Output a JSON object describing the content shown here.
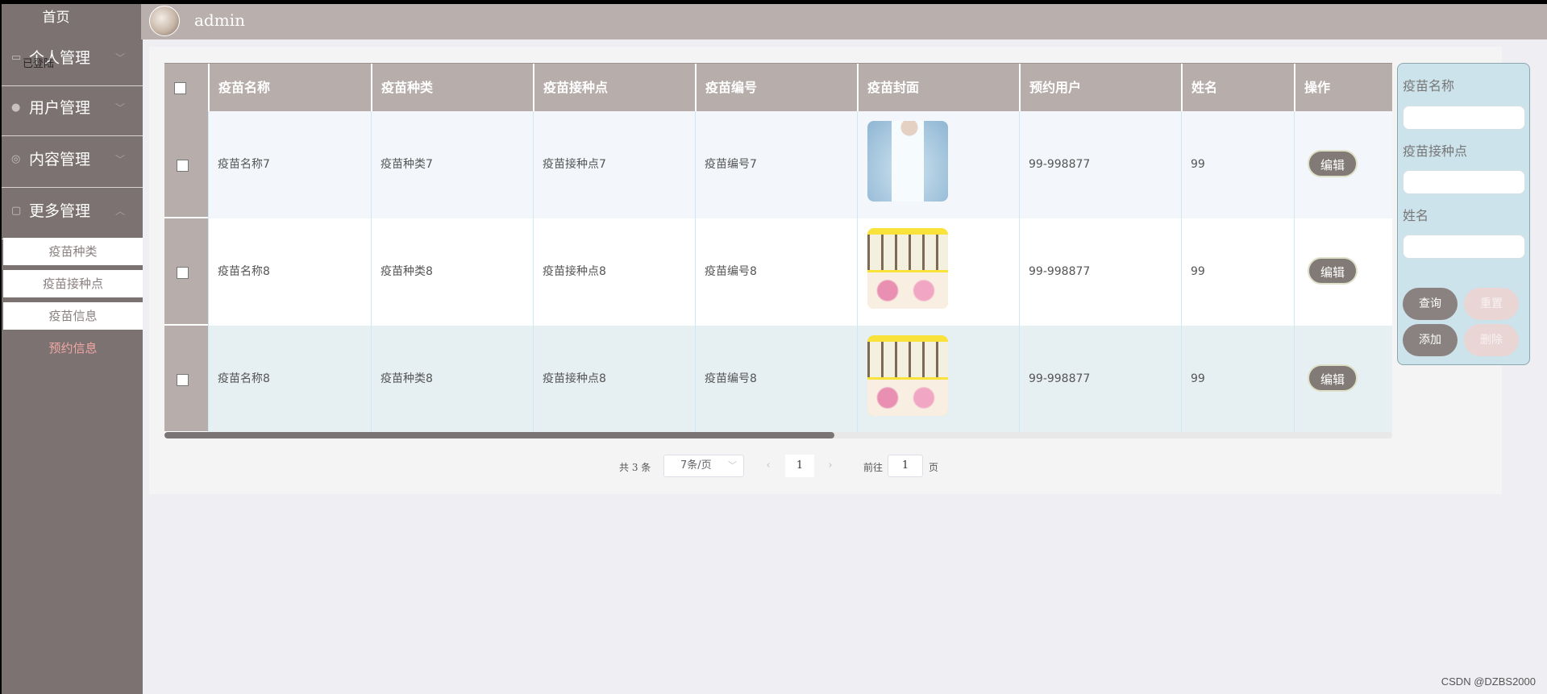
{
  "sidebar": {
    "home": "首页",
    "overlap_text": "已登陆",
    "groups": [
      {
        "label": "个人管理",
        "icon": "home-icon"
      },
      {
        "label": "用户管理",
        "icon": "user-icon"
      },
      {
        "label": "内容管理",
        "icon": "content-icon"
      },
      {
        "label": "更多管理",
        "icon": "more-icon"
      }
    ],
    "sub_items": [
      "疫苗种类",
      "疫苗接种点",
      "疫苗信息",
      "预约信息"
    ]
  },
  "header": {
    "username": "admin"
  },
  "table": {
    "columns": [
      "疫苗名称",
      "疫苗种类",
      "疫苗接种点",
      "疫苗编号",
      "疫苗封面",
      "预约用户",
      "姓名",
      "操作"
    ],
    "rows": [
      {
        "name": "疫苗名称7",
        "type": "疫苗种类7",
        "site": "疫苗接种点7",
        "code": "疫苗编号7",
        "cover": "doctor-image",
        "user": "99-998877",
        "person": "99",
        "action": "编辑"
      },
      {
        "name": "疫苗名称8",
        "type": "疫苗种类8",
        "site": "疫苗接种点8",
        "code": "疫苗编号8",
        "cover": "vials-image",
        "user": "99-998877",
        "person": "99",
        "action": "编辑"
      },
      {
        "name": "疫苗名称8",
        "type": "疫苗种类8",
        "site": "疫苗接种点8",
        "code": "疫苗编号8",
        "cover": "vials-image",
        "user": "99-998877",
        "person": "99",
        "action": "编辑"
      }
    ]
  },
  "pagination": {
    "total": "共 3 条",
    "page_size": "7条/页",
    "current": "1",
    "goto_label": "前往",
    "goto_value": "1",
    "page_suffix": "页"
  },
  "search": {
    "fields": [
      "疫苗名称",
      "疫苗接种点",
      "姓名"
    ],
    "buttons": {
      "query": "查询",
      "reset": "重置",
      "add": "添加",
      "delete": "删除"
    }
  },
  "watermark": "CSDN @DZBS2000",
  "colors": {
    "sidebar_bg": "#7b7271",
    "header_bg": "#b9b0ae",
    "table_header_bg": "#b7aeac",
    "search_bg": "#cde3eb",
    "active_sub_item": "#f2a7a4"
  }
}
